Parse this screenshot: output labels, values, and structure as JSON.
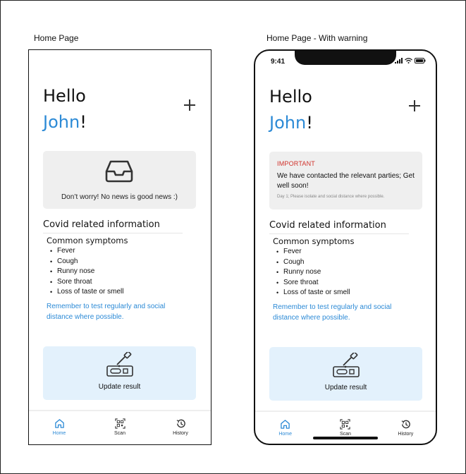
{
  "frames": [
    {
      "label": "Home Page",
      "status_time": "",
      "greeting": {
        "hello": "Hello",
        "name": "John",
        "punct": "!"
      },
      "news_text": "Don’t worry! No news is good news :)",
      "warning": null
    },
    {
      "label": "Home Page - With warning",
      "status_time": "9:41",
      "greeting": {
        "hello": "Hello",
        "name": "John",
        "punct": "!"
      },
      "news_text": "",
      "warning": {
        "title": "IMPORTANT",
        "body": "We have contacted the relevant parties; Get well soon!",
        "note": "Day 1; Please isolate and social distance where possible."
      }
    }
  ],
  "covid": {
    "section_title": "Covid related information",
    "symptoms_title": "Common symptoms",
    "symptoms": [
      "Fever",
      "Cough",
      "Runny nose",
      "Sore throat",
      "Loss of taste or smell"
    ],
    "reminder": "Remember to test regularly and social distance where possible."
  },
  "update_card": {
    "label": "Update result",
    "icon": "test-kit-icon"
  },
  "tabs": [
    {
      "label": "Home",
      "icon": "home-icon",
      "active": true
    },
    {
      "label": "Scan",
      "icon": "qr-scan-icon",
      "active": false
    },
    {
      "label": "History",
      "icon": "history-icon",
      "active": false
    }
  ],
  "colors": {
    "accent": "#2c8ad6",
    "warning_red": "#d0302a",
    "card_grey": "#efefef",
    "update_card_bg": "#e3f1fc"
  }
}
